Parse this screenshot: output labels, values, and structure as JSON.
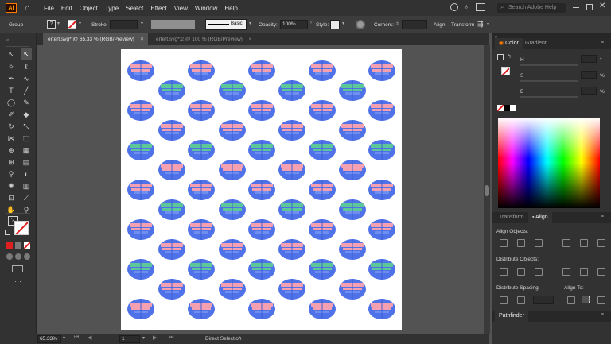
{
  "menubar": {
    "logo": "Ai",
    "items": [
      "File",
      "Edit",
      "Object",
      "Type",
      "Select",
      "Effect",
      "View",
      "Window",
      "Help"
    ],
    "search_placeholder": "Search Adobe Help"
  },
  "controlbar": {
    "selection_type": "Group",
    "stroke_label": "Stroke:",
    "stroke_profile": "Basic",
    "opacity_label": "Opacity:",
    "opacity_value": "100%",
    "style_label": "Style:",
    "corners_label": "Corners:",
    "align_label": "Align",
    "transform_label": "Transform"
  },
  "tabs": [
    {
      "label": "ertert.svg* @ 65.33 % (RGB/Preview)",
      "close": "×",
      "active": true
    },
    {
      "label": "ertert.svg*:2 @ 100 % (RGB/Preview)",
      "close": "×",
      "active": false
    }
  ],
  "statusbar": {
    "zoom": "65.33%",
    "artboard": "1",
    "tool": "Direct Selection"
  },
  "color_panel": {
    "tabs": [
      "Color",
      "Gradient"
    ],
    "channels": [
      {
        "label": "H",
        "unit": "°"
      },
      {
        "label": "S",
        "unit": "%"
      },
      {
        "label": "B",
        "unit": "%"
      }
    ]
  },
  "align_panel": {
    "tabs": [
      "Transform",
      "Align"
    ],
    "align_objects": "Align Objects:",
    "distribute_objects": "Distribute Objects:",
    "distribute_spacing": "Distribute Spacing:",
    "align_to": "Align To:"
  },
  "pathfinder_panel": {
    "title": "Pathfinder"
  },
  "colors": {
    "blue": "#4f72e8",
    "pink": "#f4a0b0",
    "green": "#5ec79a",
    "canvas": "#ffffff"
  },
  "pattern": {
    "rows": [
      {
        "variant": "pink",
        "shift": false
      },
      {
        "variant": "green",
        "shift": true
      },
      {
        "variant": "pink",
        "shift": false
      },
      {
        "variant": "pink",
        "shift": true
      },
      {
        "variant": "green",
        "shift": false
      },
      {
        "variant": "pink",
        "shift": true
      },
      {
        "variant": "pink",
        "shift": false
      },
      {
        "variant": "green",
        "shift": true
      },
      {
        "variant": "pink",
        "shift": false
      },
      {
        "variant": "pink",
        "shift": true
      },
      {
        "variant": "green",
        "shift": false
      },
      {
        "variant": "pink",
        "shift": true
      },
      {
        "variant": "pink",
        "shift": false
      }
    ]
  }
}
